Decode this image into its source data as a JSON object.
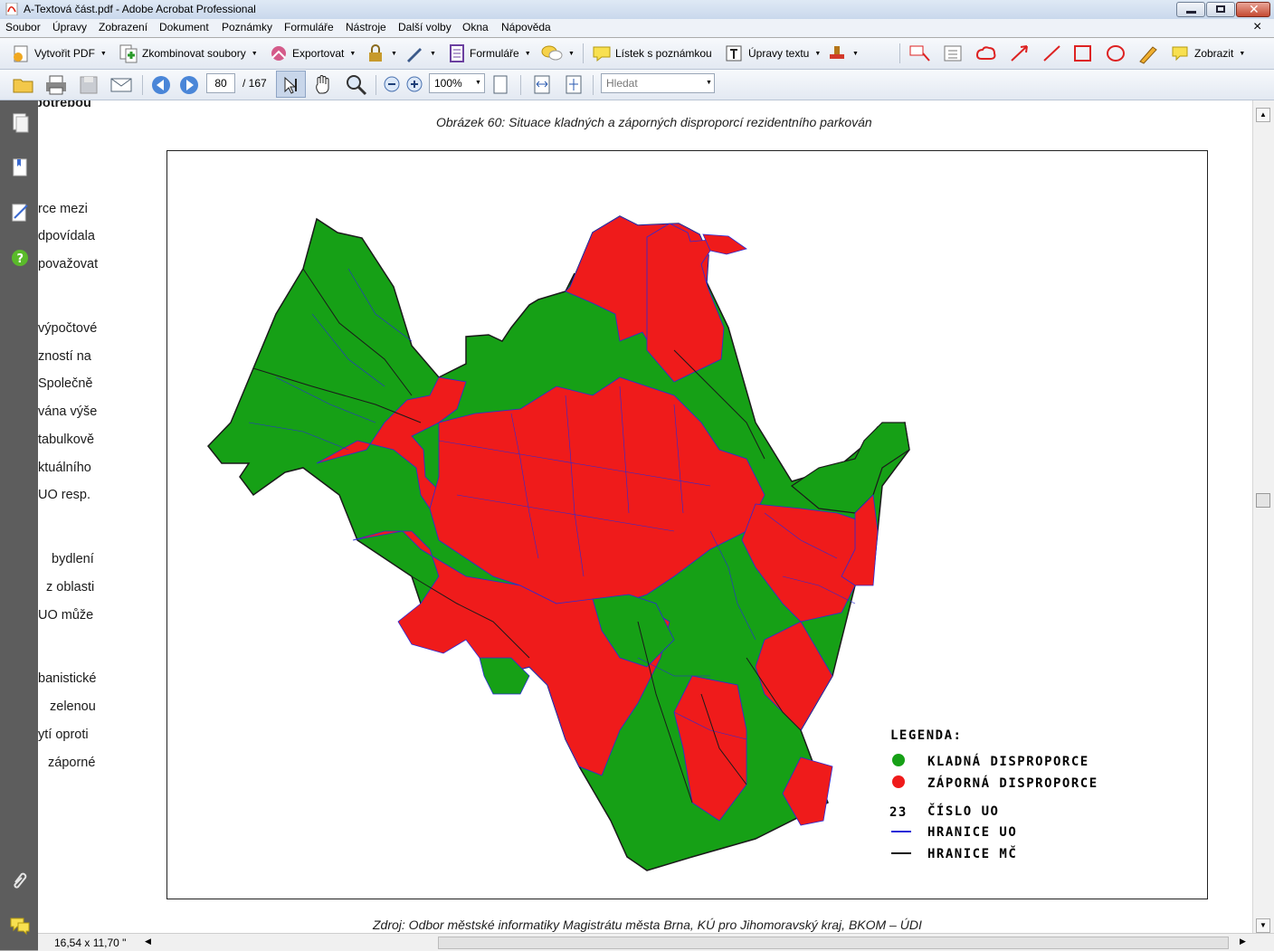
{
  "window": {
    "title": "A-Textová část.pdf - Adobe Acrobat Professional",
    "buttons": [
      "minimize",
      "maximize",
      "close"
    ]
  },
  "menubar": {
    "items": [
      "Soubor",
      "Úpravy",
      "Zobrazení",
      "Dokument",
      "Poznámky",
      "Formuláře",
      "Nástroje",
      "Další volby",
      "Okna",
      "Nápověda"
    ],
    "close_glyph": "×"
  },
  "toolbar1": {
    "create_pdf": "Vytvořit PDF",
    "combine": "Zkombinovat soubory",
    "export": "Exportovat",
    "forms": "Formuláře",
    "sticky_note": "Lístek s poznámkou",
    "text_edits": "Úpravy textu",
    "show": "Zobrazit"
  },
  "toolbar2": {
    "page_current": "80",
    "page_total": "/ 167",
    "zoom": "100%",
    "search_placeholder": "Hledat"
  },
  "document": {
    "left_fragments": [
      "potřebou",
      "rce mezi",
      "dpovídala",
      "považovat",
      "výpočtové",
      "zností na",
      "Společně",
      "vána výše",
      "tabulkově",
      "ktuálního",
      "UO resp.",
      "bydlení",
      "z oblasti",
      "UO může",
      "banistické",
      "zelenou",
      "ytí oproti",
      "záporné"
    ],
    "caption_top": "Obrázek 60: Situace kladných a záporných disproporcí rezidentního parkován",
    "caption_bottom": "Zdroj: Odbor městské informatiky Magistrátu města Brna, KÚ pro Jihomoravský kraj, BKOM – ÚDI"
  },
  "map": {
    "legend_title": "LEGENDA:",
    "legend": [
      {
        "label": "KLADNÁ DISPROPORCE",
        "color": "#16a016"
      },
      {
        "label": "ZÁPORNÁ DISPROPORCE",
        "color": "#ef1b1b"
      },
      {
        "symbol": "23",
        "label": "ČÍSLO UO"
      },
      {
        "label": "HRANICE UO",
        "color": "#2a2ad8"
      },
      {
        "label": "HRANICE MČ",
        "color": "#111111"
      }
    ],
    "positive_color": "#16a016",
    "negative_color": "#ef1b1b"
  },
  "statusbar": {
    "page_size": "16,54 x 11,70 \""
  },
  "colors": {
    "toolbar_bg": "#e8edf5",
    "panel_bg": "#5d5d5d"
  }
}
